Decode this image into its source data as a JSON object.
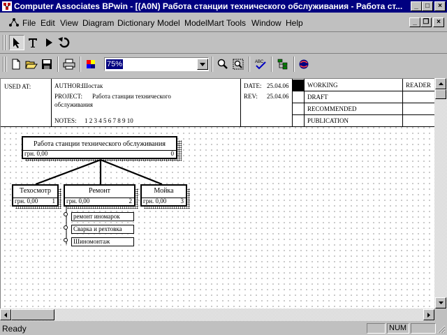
{
  "window": {
    "title": "Computer Associates BPwin - [(A0N) Работа станции технического обслуживания - Работа ст...",
    "title_bar_color": "#000080"
  },
  "window_controls": {
    "minimize": "_",
    "maximize": "□",
    "close": "×"
  },
  "doc_controls": {
    "minimize": "_",
    "restore": "❐",
    "close": "×"
  },
  "menu": [
    "File",
    "Edit",
    "View",
    "Diagram",
    "Dictionary",
    "Model",
    "ModelMart",
    "Tools",
    "Window",
    "Help"
  ],
  "toolbar": {
    "tools": [
      "pointer-tool",
      "text-tool",
      "triangle-tool",
      "undo-tool"
    ],
    "zoom_value": "75%",
    "buttons": [
      "new-icon",
      "open-icon",
      "save-icon",
      "print-icon",
      "color-icon",
      "zoom-in-icon",
      "zoom-fit-icon",
      "spell-check-icon",
      "model-explorer-icon",
      "modelmart-icon"
    ]
  },
  "frame": {
    "used_at": "USED AT:",
    "author_label": "AUTHOR:",
    "author": "Шостак",
    "project_label": "PROJECT:",
    "project_line1": "Работа станции технического",
    "project_line2": "обслуживания",
    "date_label": "DATE:",
    "date": "25.04.06",
    "rev_label": "REV:",
    "rev": "25.04.06",
    "notes_label": "NOTES:",
    "notes": "1  2  3  4  5  6  7  8  9  10",
    "statuses": [
      "WORKING",
      "DRAFT",
      "RECOMMENDED",
      "PUBLICATION"
    ],
    "reader": "READER"
  },
  "diagram": {
    "root": {
      "name": "Работа станции технического обслуживания",
      "cost": "грн. 0,00",
      "number": "0"
    },
    "children": [
      {
        "name": "Техосмотр",
        "cost": "грн. 0,00",
        "number": "1"
      },
      {
        "name": "Ремонт",
        "cost": "грн. 0,00",
        "number": "2"
      },
      {
        "name": "Мойка",
        "cost": "грн. 0,00",
        "number": "3"
      }
    ],
    "operations": [
      "ремонт иномарок",
      "Сварка и рехтовка",
      "Шиномонтаж"
    ]
  },
  "status": {
    "text": "Ready",
    "num": "NUM"
  }
}
